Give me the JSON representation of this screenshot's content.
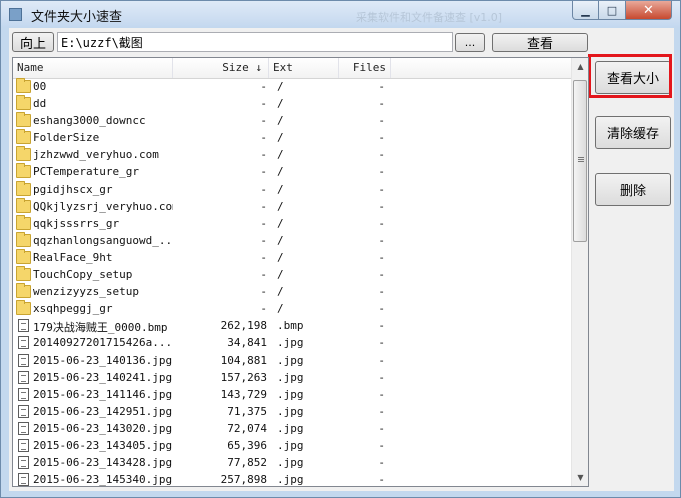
{
  "window": {
    "title": "文件夹大小速查",
    "ghost_title": "采集软件和文件备速查 [v1.0]"
  },
  "toolbar": {
    "up_button": "向上",
    "path_value": "E:\\uzzf\\截图",
    "browse_button": "...",
    "view_button": "查看"
  },
  "side_buttons": {
    "check_size": "查看大小",
    "clear_cache": "清除缓存",
    "delete": "删除"
  },
  "list": {
    "columns": [
      "Name",
      "Size ↓",
      "Ext",
      "Files"
    ],
    "rows": [
      {
        "type": "folder",
        "name": "00",
        "size": "-",
        "ext": "/",
        "files": "-"
      },
      {
        "type": "folder",
        "name": "dd",
        "size": "-",
        "ext": "/",
        "files": "-"
      },
      {
        "type": "folder",
        "name": "eshang3000_downcc",
        "size": "-",
        "ext": "/",
        "files": "-"
      },
      {
        "type": "folder",
        "name": "FolderSize",
        "size": "-",
        "ext": "/",
        "files": "-"
      },
      {
        "type": "folder",
        "name": "jzhzwwd_veryhuo.com",
        "size": "-",
        "ext": "/",
        "files": "-"
      },
      {
        "type": "folder",
        "name": "PCTemperature_gr",
        "size": "-",
        "ext": "/",
        "files": "-"
      },
      {
        "type": "folder",
        "name": "pgidjhscx_gr",
        "size": "-",
        "ext": "/",
        "files": "-"
      },
      {
        "type": "folder",
        "name": "QQkjlyzsrj_veryhuo.com",
        "size": "-",
        "ext": "/",
        "files": "-"
      },
      {
        "type": "folder",
        "name": "qqkjsssrrs_gr",
        "size": "-",
        "ext": "/",
        "files": "-"
      },
      {
        "type": "folder",
        "name": "qqzhanlongsanguowd_...",
        "size": "-",
        "ext": "/",
        "files": "-"
      },
      {
        "type": "folder",
        "name": "RealFace_9ht",
        "size": "-",
        "ext": "/",
        "files": "-"
      },
      {
        "type": "folder",
        "name": "TouchCopy_setup",
        "size": "-",
        "ext": "/",
        "files": "-"
      },
      {
        "type": "folder",
        "name": "wenzizyyzs_setup",
        "size": "-",
        "ext": "/",
        "files": "-"
      },
      {
        "type": "folder",
        "name": "xsqhpeggj_gr",
        "size": "-",
        "ext": "/",
        "files": "-"
      },
      {
        "type": "file",
        "name": "179决战海贼王_0000.bmp",
        "size": "262,198",
        "ext": ".bmp",
        "files": "-"
      },
      {
        "type": "file",
        "name": "20140927201715426a...",
        "size": "34,841",
        "ext": ".jpg",
        "files": "-"
      },
      {
        "type": "file",
        "name": "2015-06-23_140136.jpg",
        "size": "104,881",
        "ext": ".jpg",
        "files": "-"
      },
      {
        "type": "file",
        "name": "2015-06-23_140241.jpg",
        "size": "157,263",
        "ext": ".jpg",
        "files": "-"
      },
      {
        "type": "file",
        "name": "2015-06-23_141146.jpg",
        "size": "143,729",
        "ext": ".jpg",
        "files": "-"
      },
      {
        "type": "file",
        "name": "2015-06-23_142951.jpg",
        "size": "71,375",
        "ext": ".jpg",
        "files": "-"
      },
      {
        "type": "file",
        "name": "2015-06-23_143020.jpg",
        "size": "72,074",
        "ext": ".jpg",
        "files": "-"
      },
      {
        "type": "file",
        "name": "2015-06-23_143405.jpg",
        "size": "65,396",
        "ext": ".jpg",
        "files": "-"
      },
      {
        "type": "file",
        "name": "2015-06-23_143428.jpg",
        "size": "77,852",
        "ext": ".jpg",
        "files": "-"
      },
      {
        "type": "file",
        "name": "2015-06-23_145340.jpg",
        "size": "257,898",
        "ext": ".jpg",
        "files": "-"
      }
    ]
  }
}
